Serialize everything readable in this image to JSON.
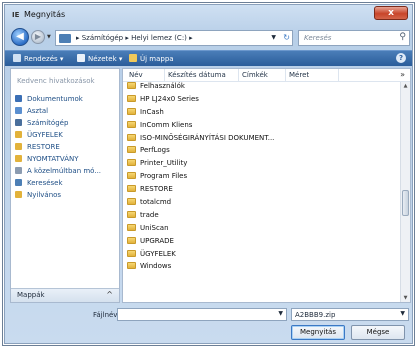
{
  "window": {
    "title": "Megnyitás",
    "app_icon": "IE",
    "close_label": "x"
  },
  "nav": {
    "address_path": "▸ Számítógép ▸ Helyi lemez (C:) ▸",
    "search_placeholder": "Keresés"
  },
  "toolbar": {
    "organize_label": "Rendezés ▾",
    "views_label": "Nézetek ▾",
    "new_folder_label": "Új mappa",
    "help_label": "?"
  },
  "sidebar": {
    "header": "Kedvenc hivatkozások",
    "items": [
      {
        "label": "Dokumentumok",
        "icon": "documents-icon",
        "color": "#3b6fb5"
      },
      {
        "label": "Asztal",
        "icon": "desktop-icon",
        "color": "#5a8fd0"
      },
      {
        "label": "Számítógép",
        "icon": "computer-icon",
        "color": "#4a6f9c"
      },
      {
        "label": "ÜGYFELEK",
        "icon": "folder-icon",
        "color": "#e2b23b"
      },
      {
        "label": "RESTORE",
        "icon": "folder-icon",
        "color": "#e2b23b"
      },
      {
        "label": "NYOMTATVÁNY",
        "icon": "folder-icon",
        "color": "#e2b23b"
      },
      {
        "label": "A közelmúltban mó...",
        "icon": "recent-icon",
        "color": "#8b9bb0"
      },
      {
        "label": "Keresések",
        "icon": "search-folder-icon",
        "color": "#4d7fb5"
      },
      {
        "label": "Nyilvános",
        "icon": "public-folder-icon",
        "color": "#e2b23b"
      }
    ],
    "folders_label": "Mappák",
    "folders_chevron": "^"
  },
  "columns": {
    "name": "Név",
    "date": "Készítés dátuma",
    "tags": "Címkék",
    "size": "Méret",
    "more": "»"
  },
  "files": [
    "Felhasználók",
    "HP LJ24x0 Series",
    "InCash",
    "InComm Kliens",
    "ISO-MINŐSÉGIRÁNYÍTÁSI DOKUMENT...",
    "PerfLogs",
    "Printer_Utility",
    "Program Files",
    "RESTORE",
    "totalcmd",
    "trade",
    "UniScan",
    "UPGRADE",
    "ÜGYFELEK",
    "Windows"
  ],
  "bottom": {
    "filename_label": "Fájlnév:",
    "filename_value": "",
    "filter_value": "A2BBB9.zip",
    "open_label": "Megnyitás",
    "cancel_label": "Mégse"
  }
}
